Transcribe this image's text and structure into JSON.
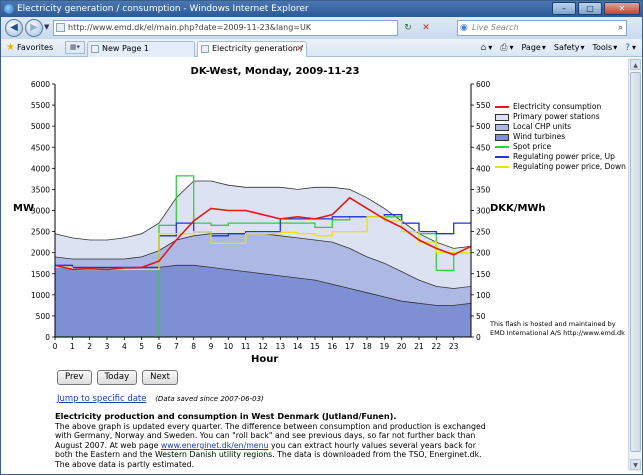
{
  "window": {
    "title": "Electricity generation / consumption - Windows Internet Explorer",
    "minimize": "–",
    "maximize": "□",
    "close": "✕"
  },
  "navbar": {
    "back_icon": "back-arrow-icon",
    "forward_icon": "forward-arrow-icon",
    "url": "http://www.emd.dk/el/main.php?date=2009-11-23&lang=UK",
    "search_placeholder": "Live Search"
  },
  "tabbar": {
    "favorites_label": "Favorites",
    "tabs": [
      {
        "label": "New Page 1"
      },
      {
        "label": "Electricity generation / ..."
      }
    ],
    "commands": [
      {
        "icon": "home-icon",
        "label": ""
      },
      {
        "icon": "print-icon",
        "label": ""
      },
      {
        "icon": "page-icon",
        "label": "Page"
      },
      {
        "icon": "safety-icon",
        "label": "Safety"
      },
      {
        "icon": "tools-icon",
        "label": "Tools"
      },
      {
        "icon": "help-icon",
        "label": ""
      }
    ]
  },
  "chart_data": {
    "type": "area",
    "title": "DK-West, Monday, 2009-11-23",
    "xlabel": "Hour",
    "ylabel_left": "MW",
    "ylabel_right": "DKK/MWh",
    "xlim": [
      0,
      24
    ],
    "ylim_left": [
      0,
      6000
    ],
    "ylim_right": [
      0,
      600
    ],
    "x_ticks": [
      0,
      1,
      2,
      3,
      4,
      5,
      6,
      7,
      8,
      9,
      10,
      11,
      12,
      13,
      14,
      15,
      16,
      17,
      18,
      19,
      20,
      21,
      22,
      23
    ],
    "y_ticks_left": [
      0,
      500,
      1000,
      1500,
      2000,
      2500,
      3000,
      3500,
      4000,
      4500,
      5000,
      5500,
      6000
    ],
    "y_ticks_right": [
      0,
      50,
      100,
      150,
      200,
      250,
      300,
      350,
      400,
      450,
      500,
      550,
      600
    ],
    "x": [
      0,
      1,
      2,
      3,
      4,
      5,
      6,
      7,
      8,
      9,
      10,
      11,
      12,
      13,
      14,
      15,
      16,
      17,
      18,
      19,
      20,
      21,
      22,
      23,
      24
    ],
    "series": [
      {
        "name": "Primary power stations",
        "kind": "area",
        "color": "#dde2f2",
        "values": [
          2450,
          2350,
          2300,
          2300,
          2350,
          2450,
          2700,
          3300,
          3700,
          3700,
          3600,
          3550,
          3550,
          3550,
          3500,
          3550,
          3550,
          3500,
          3300,
          3050,
          2750,
          2450,
          2250,
          2100,
          2150
        ]
      },
      {
        "name": "Local CHP units",
        "kind": "area",
        "color": "#aeb8e4",
        "values": [
          1900,
          1850,
          1850,
          1850,
          1850,
          1900,
          2050,
          2300,
          2400,
          2450,
          2450,
          2450,
          2450,
          2400,
          2350,
          2300,
          2250,
          2100,
          1900,
          1750,
          1550,
          1350,
          1200,
          1150,
          1200
        ]
      },
      {
        "name": "Wind turbines",
        "kind": "area",
        "color": "#7f8fd3",
        "values": [
          1650,
          1650,
          1650,
          1650,
          1650,
          1650,
          1650,
          1700,
          1700,
          1650,
          1600,
          1550,
          1500,
          1450,
          1400,
          1350,
          1250,
          1150,
          1050,
          950,
          850,
          800,
          750,
          750,
          800
        ]
      },
      {
        "name": "Electricity consumption",
        "kind": "line",
        "color": "#e01a1a",
        "values": [
          1700,
          1600,
          1620,
          1600,
          1640,
          1650,
          1800,
          2300,
          2750,
          3050,
          3000,
          3000,
          2900,
          2800,
          2850,
          2800,
          2900,
          3300,
          3050,
          2800,
          2600,
          2300,
          2100,
          1950,
          2150
        ]
      },
      {
        "name": "Spot price",
        "kind": "step",
        "axis": "right",
        "color": "#33cc44",
        "values": [
          0,
          0,
          0,
          0,
          0,
          0,
          265,
          382,
          270,
          265,
          270,
          270,
          270,
          270,
          270,
          260,
          278,
          285,
          285,
          285,
          270,
          245,
          158,
          200,
          200
        ]
      },
      {
        "name": "Regulating power price, Up",
        "kind": "step",
        "axis": "right",
        "color": "#2233dd",
        "values": [
          170,
          165,
          165,
          165,
          165,
          165,
          240,
          270,
          250,
          240,
          245,
          250,
          250,
          280,
          280,
          280,
          285,
          285,
          285,
          290,
          270,
          250,
          245,
          270,
          270
        ]
      },
      {
        "name": "Regulating power price, Down",
        "kind": "step",
        "axis": "right",
        "color": "#e6e600",
        "values": [
          165,
          160,
          160,
          160,
          160,
          160,
          245,
          245,
          250,
          222,
          222,
          245,
          245,
          248,
          245,
          240,
          250,
          250,
          285,
          275,
          250,
          225,
          200,
          200,
          200
        ]
      }
    ],
    "legend_position": "right",
    "grid": false
  },
  "legend": {
    "items": [
      {
        "label": "Electricity consumption",
        "color": "#e01a1a",
        "style": "line"
      },
      {
        "label": "Primary power stations",
        "color": "#dde2f2",
        "style": "box"
      },
      {
        "label": "Local CHP units",
        "color": "#aeb8e4",
        "style": "box"
      },
      {
        "label": "Wind turbines",
        "color": "#7f8fd3",
        "style": "box"
      },
      {
        "label": "Spot price",
        "color": "#33cc44",
        "style": "line"
      },
      {
        "label": "Regulating power price, Up",
        "color": "#2233dd",
        "style": "line"
      },
      {
        "label": "Regulating power price, Down",
        "color": "#e6e600",
        "style": "line"
      }
    ]
  },
  "flash_note": "This flash is hosted and maintained by EMD International A/S http://www.emd.dk",
  "buttons": {
    "prev": "Prev",
    "today": "Today",
    "next": "Next"
  },
  "jump": {
    "link": "Jump to specific date",
    "saved": "(Data saved since 2007-06-03)"
  },
  "description": {
    "title": "Electricity production and consumption in West Denmark (Jutland/Funen).",
    "body_1": "The above graph is updated every quarter. The difference between consumption and production is exchanged with Germany, Norway and Sweden. You can \"roll back\" and see previous days, so far not further back than August 2007. At web page ",
    "link": "www.energinet.dk/en/menu",
    "body_2": " you can extract hourly values several years back for both the Eastern and the Western Danish utility regions. The data is downloaded from the TSO, Energinet.dk. The above data is partly estimated."
  }
}
